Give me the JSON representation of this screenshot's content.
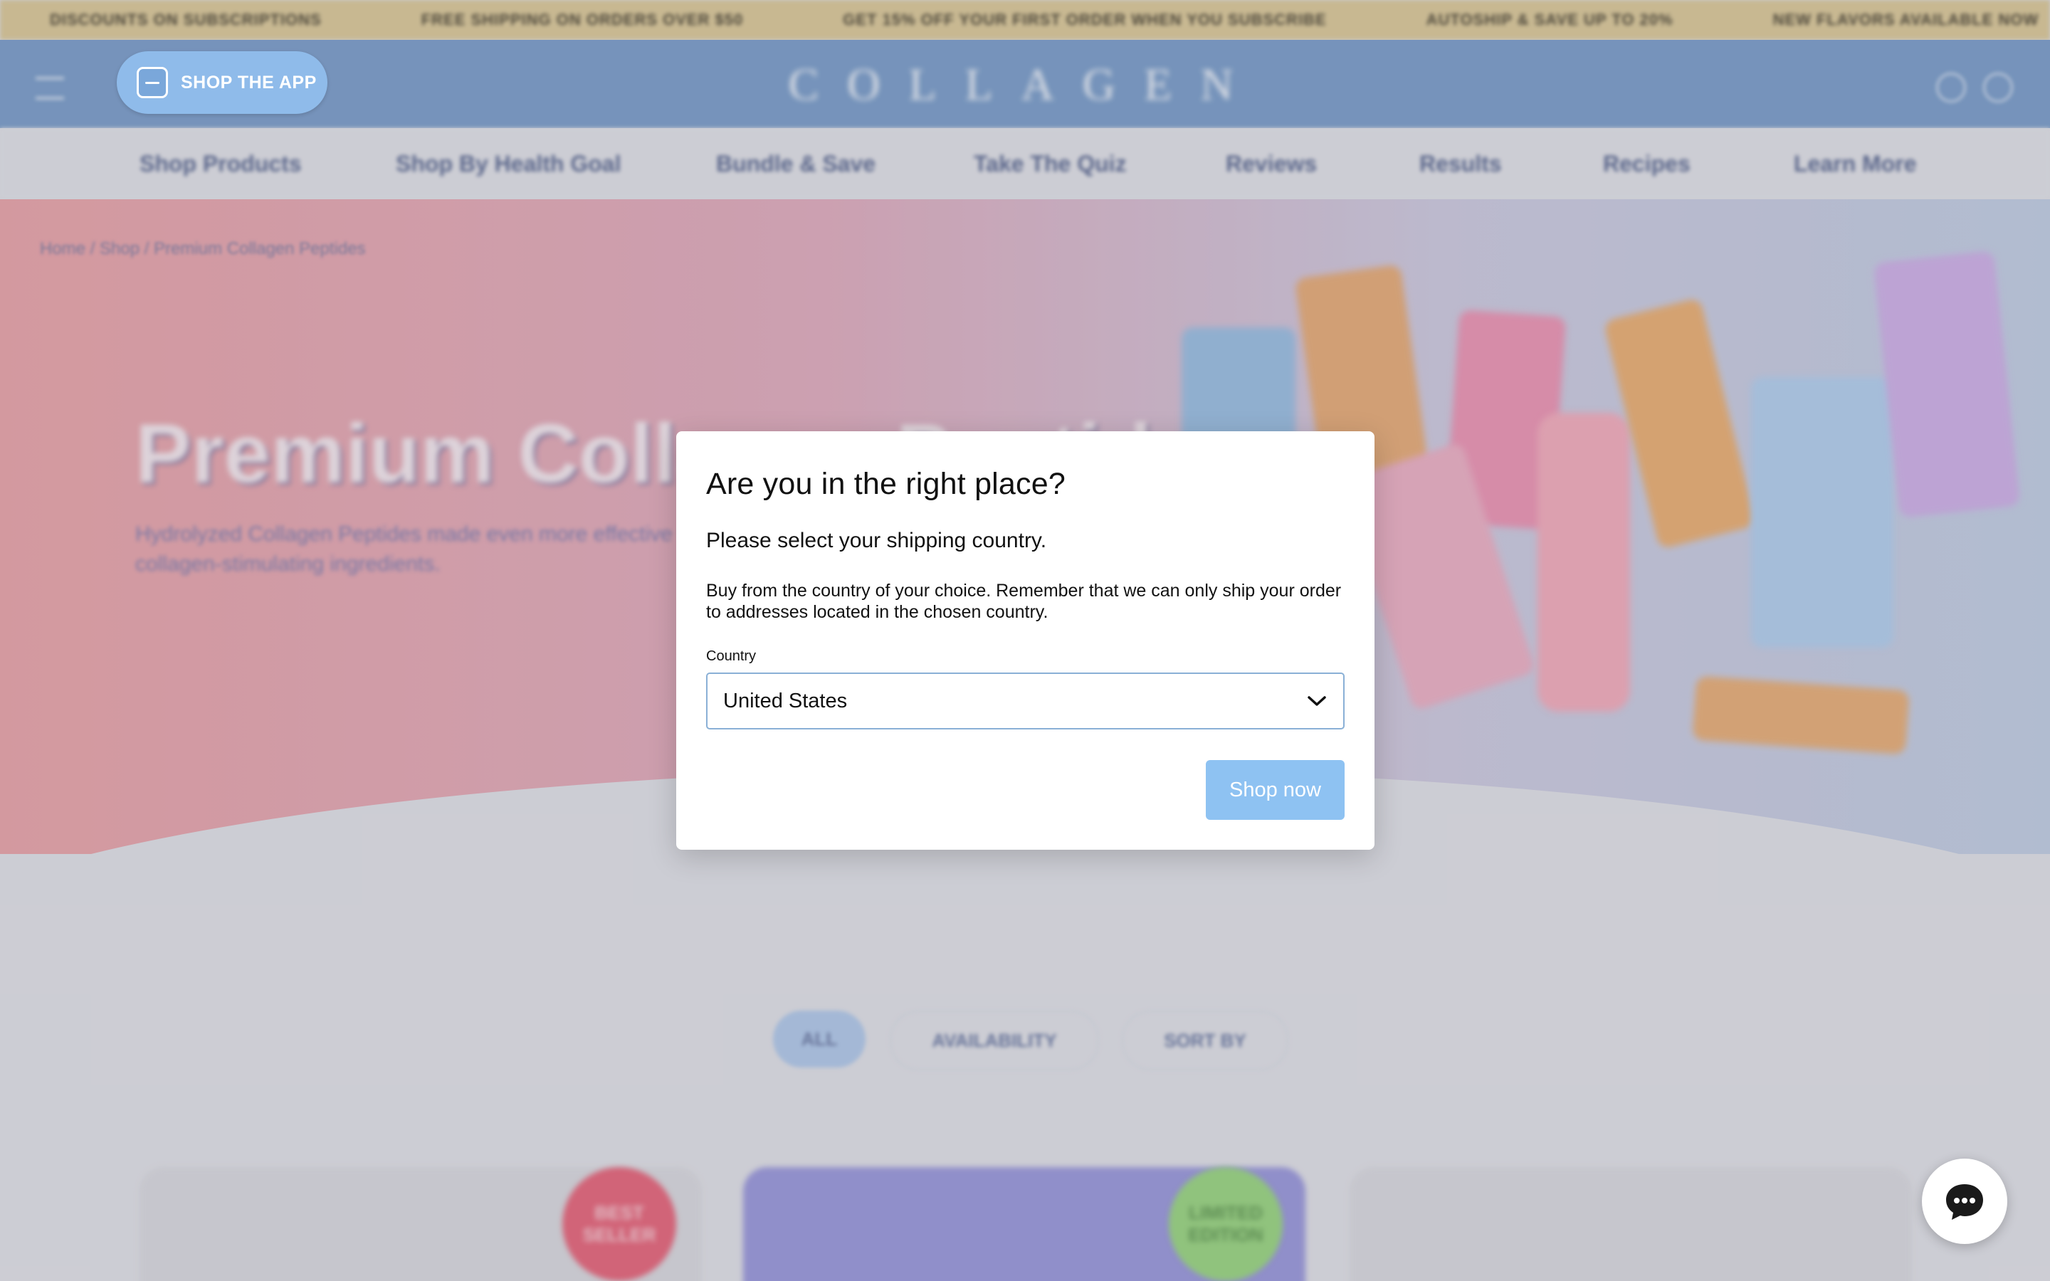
{
  "announcement": {
    "items": [
      "DISCOUNTS ON SUBSCRIPTIONS",
      "FREE SHIPPING ON ORDERS OVER $50",
      "GET 15% OFF YOUR FIRST ORDER WHEN YOU SUBSCRIBE",
      "AUTOSHIP & SAVE UP TO 20%",
      "NEW FLAVORS AVAILABLE NOW"
    ]
  },
  "header": {
    "logo_text": "COLLAGEN",
    "shop_app_label": "SHOP THE APP"
  },
  "nav": {
    "items": [
      "Shop Products",
      "Shop By Health Goal",
      "Bundle & Save",
      "Take The Quiz",
      "Reviews",
      "Results",
      "Recipes",
      "Learn More"
    ]
  },
  "hero": {
    "breadcrumb": "Home / Shop / Premium Collagen Peptides",
    "title": "Premium Collagen Peptides",
    "subtitle": "Hydrolyzed Collagen Peptides made even more effective with collagen-stimulating ingredients."
  },
  "filters": {
    "all_label": "ALL",
    "availability_label": "AVAILABILITY",
    "sort_label": "SORT BY"
  },
  "badges": {
    "best_seller": "BEST SELLER",
    "limited_edition": "LIMITED EDITION"
  },
  "modal": {
    "title": "Are you in the right place?",
    "subtitle": "Please select your shipping country.",
    "description": "Buy from the country of your choice. Remember that we can only ship your order to addresses located in the chosen country.",
    "country_label": "Country",
    "country_value": "United States",
    "shop_now_label": "Shop now"
  },
  "colors": {
    "accent_button": "#8ec2f2",
    "header_blue": "#6d93c3",
    "select_border": "#8ab0d6"
  },
  "icons": {
    "chat": "chat-bubble-icon",
    "dropdown": "chevron-down-icon",
    "app": "app-icon"
  }
}
